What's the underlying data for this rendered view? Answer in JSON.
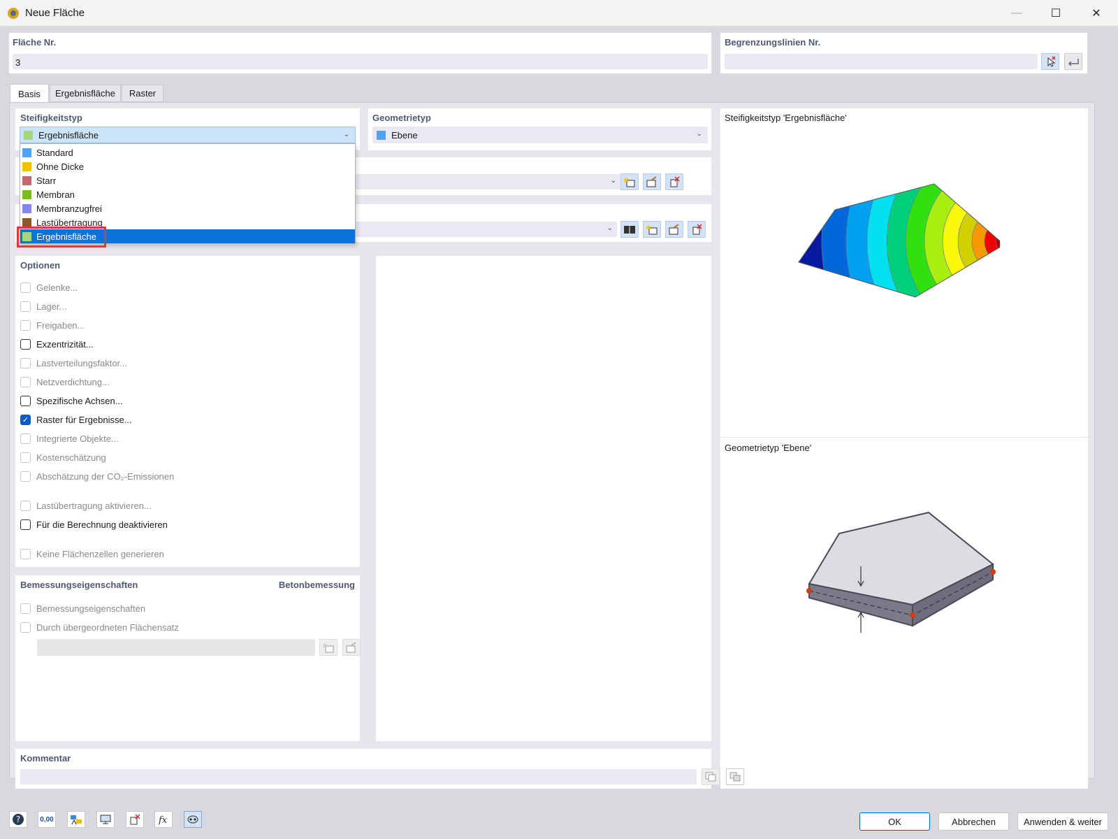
{
  "window": {
    "title": "Neue Fläche",
    "minimize_glyph": "—",
    "maximize_glyph": "☐",
    "close_glyph": "✕"
  },
  "surface_no": {
    "label": "Fläche Nr.",
    "value": "3"
  },
  "boundary": {
    "label": "Begrenzungslinien Nr.",
    "value": ""
  },
  "tabs": [
    {
      "label": "Basis"
    },
    {
      "label": "Ergebnisfläche"
    },
    {
      "label": "Raster"
    }
  ],
  "stiffness": {
    "label": "Steifigkeitstyp",
    "selected": "Ergebnisfläche",
    "selected_color": "#a6d67a",
    "options": [
      {
        "label": "Standard",
        "color": "#4da3f5"
      },
      {
        "label": "Ohne Dicke",
        "color": "#f0c000"
      },
      {
        "label": "Starr",
        "color": "#c06a6e"
      },
      {
        "label": "Membran",
        "color": "#7abd1e"
      },
      {
        "label": "Membranzugfrei",
        "color": "#8585f0"
      },
      {
        "label": "Lastübertragung",
        "color": "#8a5a2a"
      },
      {
        "label": "Ergebnisfläche",
        "color": "#a6d67a"
      }
    ]
  },
  "geometry": {
    "label": "Geometrietyp",
    "selected": "Ebene",
    "selected_color": "#4da3f5"
  },
  "options": {
    "label": "Optionen",
    "items": [
      {
        "label": "Gelenke...",
        "enabled": false,
        "checked": false
      },
      {
        "label": "Lager...",
        "enabled": false,
        "checked": false
      },
      {
        "label": "Freigaben...",
        "enabled": false,
        "checked": false
      },
      {
        "label": "Exzentrizität...",
        "enabled": true,
        "checked": false
      },
      {
        "label": "Lastverteilungsfaktor...",
        "enabled": false,
        "checked": false
      },
      {
        "label": "Netzverdichtung...",
        "enabled": false,
        "checked": false
      },
      {
        "label": "Spezifische Achsen...",
        "enabled": true,
        "checked": false
      },
      {
        "label": "Raster für Ergebnisse...",
        "enabled": true,
        "checked": true
      },
      {
        "label": "Integrierte Objekte...",
        "enabled": false,
        "checked": false
      },
      {
        "label": "Kostenschätzung",
        "enabled": false,
        "checked": false
      },
      {
        "label": "Abschätzung der CO₂-Emissionen",
        "enabled": false,
        "checked": false
      },
      {
        "label": "Lastübertragung aktivieren...",
        "enabled": false,
        "checked": false
      },
      {
        "label": "Für die Berechnung deaktivieren",
        "enabled": true,
        "checked": false
      },
      {
        "label": "Keine Flächenzellen generieren",
        "enabled": false,
        "checked": false
      }
    ]
  },
  "design": {
    "label": "Bemessungseigenschaften",
    "right_label": "Betonbemessung",
    "items": [
      {
        "label": "Bemessungseigenschaften"
      },
      {
        "label": "Durch übergeordneten Flächensatz"
      }
    ]
  },
  "comment": {
    "label": "Kommentar",
    "value": ""
  },
  "preview": {
    "stiffness_caption": "Steifigkeitstyp 'Ergebnisfläche'",
    "geometry_caption": "Geometrietyp 'Ebene'"
  },
  "buttons": {
    "ok": "OK",
    "cancel": "Abbrechen",
    "apply": "Anwenden & weiter"
  },
  "bottom_icons": {
    "units_value": "0,00"
  },
  "colors": {
    "accent": "#0a74d8",
    "highlight_border": "#e8323c"
  }
}
